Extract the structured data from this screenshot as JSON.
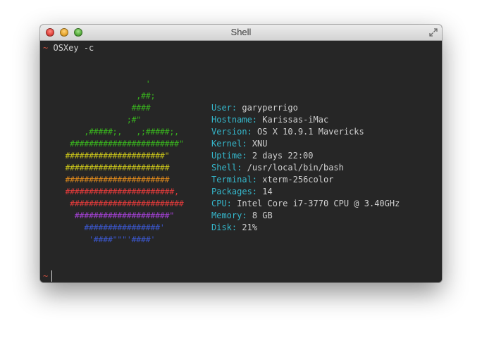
{
  "window": {
    "title": "Shell"
  },
  "icons": {
    "fullscreen": "fullscreen-arrows-icon",
    "close": "close-light",
    "minimize": "minimize-light",
    "zoom": "zoom-light"
  },
  "colors": {
    "terminal_bg": "#262626",
    "prompt": "#cc5040",
    "key": "#35b8cc",
    "green": "#39b51e",
    "yellow": "#c7c21a",
    "orange": "#d9861c",
    "red": "#e03a3a",
    "purple": "#a040d0",
    "blue": "#3a55c8"
  },
  "terminal": {
    "prompt_symbol": "~",
    "command": "OSXey -c",
    "final_prompt": "~"
  },
  "logo": [
    {
      "text": "                   '",
      "color": "green"
    },
    {
      "text": "                 ,##;",
      "color": "green"
    },
    {
      "text": "                ####",
      "color": "green"
    },
    {
      "text": "               ;#\"",
      "color": "green"
    },
    {
      "text": "      ,#####;,   ,;#####;,",
      "color": "green"
    },
    {
      "text": "   #######################\"",
      "color": "green"
    },
    {
      "text": "  #####################\"",
      "color": "yellow"
    },
    {
      "text": "  ######################",
      "color": "yellow"
    },
    {
      "text": "  ######################",
      "color": "orange"
    },
    {
      "text": "  #######################,",
      "color": "red"
    },
    {
      "text": "   ########################",
      "color": "red"
    },
    {
      "text": "    ####################\"",
      "color": "purple"
    },
    {
      "text": "      ################'",
      "color": "blue"
    },
    {
      "text": "       '####\"\"\"'####'",
      "color": "blue"
    }
  ],
  "info": [
    {
      "key": "User:",
      "value": "garyperrigo"
    },
    {
      "key": "Hostname:",
      "value": "Karissas-iMac"
    },
    {
      "key": "Version:",
      "value": "OS X 10.9.1 Mavericks"
    },
    {
      "key": "Kernel:",
      "value": "XNU"
    },
    {
      "key": "Uptime:",
      "value": "2 days 22:00"
    },
    {
      "key": "Shell:",
      "value": "/usr/local/bin/bash"
    },
    {
      "key": "Terminal:",
      "value": "xterm-256color"
    },
    {
      "key": "Packages:",
      "value": "14"
    },
    {
      "key": "CPU:",
      "value": "Intel Core i7-3770 CPU @ 3.40GHz"
    },
    {
      "key": "Memory:",
      "value": "8 GB"
    },
    {
      "key": "Disk:",
      "value": "21%"
    }
  ]
}
